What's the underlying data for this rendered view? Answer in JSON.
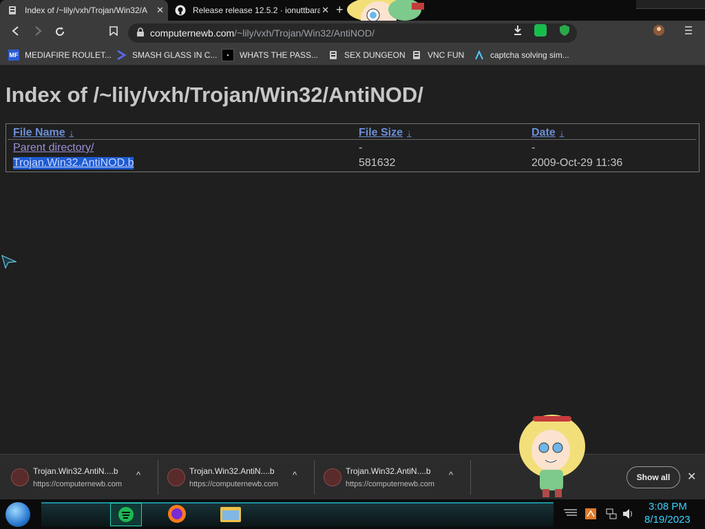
{
  "tabs": [
    {
      "title": "Index of /~lily/vxh/Trojan/Win32/A",
      "active": true,
      "icon": "server-icon"
    },
    {
      "title": "Release release 12.5.2 · ionuttbara/",
      "active": false,
      "icon": "github-icon"
    }
  ],
  "toolbar": {
    "url_host": "computernewb.com",
    "url_path": "/~lily/vxh/Trojan/Win32/AntiNOD/"
  },
  "bookmarks": [
    {
      "label": "MEDIAFIRE ROULET...",
      "icon": "mediafire-icon"
    },
    {
      "label": "SMASH GLASS IN C...",
      "icon": "bracket-icon"
    },
    {
      "label": "WHATS THE PASS...",
      "icon": "terminal-icon"
    },
    {
      "label": "SEX DUNGEON",
      "icon": "server-icon"
    },
    {
      "label": "VNC FUN",
      "icon": "server-icon"
    },
    {
      "label": "captcha solving sim...",
      "icon": "lambda-icon"
    }
  ],
  "page": {
    "heading": "Index of /~lily/vxh/Trojan/Win32/AntiNOD/",
    "columns": {
      "name": "File Name",
      "size": "File Size",
      "date": "Date",
      "sort_glyph": "↓"
    },
    "rows": [
      {
        "name": "Parent directory/",
        "size": "-",
        "date": "-"
      },
      {
        "name": "Trojan.Win32.AntiNOD.b",
        "size": "581632",
        "date": "2009-Oct-29 11:36"
      }
    ]
  },
  "downloads": [
    {
      "name": "Trojan.Win32.AntiN....b",
      "url": "https://computernewb.com"
    },
    {
      "name": "Trojan.Win32.AntiN....b",
      "url": "https://computernewb.com"
    },
    {
      "name": "Trojan.Win32.AntiN....b",
      "url": "https://computernewb.com"
    }
  ],
  "shelf": {
    "show_all": "Show all"
  },
  "clock": {
    "time": "3:08 PM",
    "date": "8/19/2023"
  },
  "colors": {
    "link": "#6c8fd8",
    "selection": "#1f5bd1",
    "clock": "#3ad1ff"
  }
}
